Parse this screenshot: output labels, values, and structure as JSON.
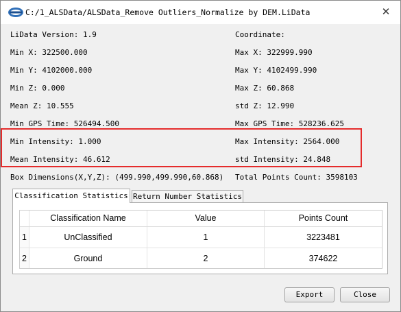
{
  "window": {
    "title": "C:/1_ALSData/ALSData_Remove Outliers_Normalize by DEM.LiData",
    "close_glyph": "✕",
    "icon": "lidar-logo-icon"
  },
  "stats": {
    "lidata_version": "LiData Version: 1.9",
    "coordinate": "Coordinate:",
    "min_x": "Min X: 322500.000",
    "max_x": "Max X: 322999.990",
    "min_y": "Min Y: 4102000.000",
    "max_y": "Max Y: 4102499.990",
    "min_z": "Min Z: 0.000",
    "max_z": "Max Z: 60.868",
    "mean_z": "Mean Z: 10.555",
    "std_z": "std Z: 12.990",
    "min_gps_time": "Min GPS Time: 526494.500",
    "max_gps_time": "Max GPS Time: 528236.625",
    "min_intensity": "Min Intensity: 1.000",
    "max_intensity": "Max Intensity: 2564.000",
    "mean_intensity": "Mean Intensity: 46.612",
    "std_intensity": "std Intensity: 24.848",
    "box_dimensions": "Box Dimensions(X,Y,Z): (499.990,499.990,60.868)",
    "total_points": "Total Points Count: 3598103"
  },
  "tabs": [
    {
      "label": "Classification Statistics",
      "active": true
    },
    {
      "label": "Return Number Statistics",
      "active": false
    }
  ],
  "table": {
    "headers": [
      "Classification Name",
      "Value",
      "Points Count"
    ],
    "rows": [
      {
        "num": "1",
        "name": "UnClassified",
        "value": "1",
        "count": "3223481"
      },
      {
        "num": "2",
        "name": "Ground",
        "value": "2",
        "count": "374622"
      }
    ]
  },
  "buttons": {
    "export": "Export",
    "close": "Close"
  },
  "colors": {
    "highlight_border": "#e52b2b",
    "window_bg": "#f0f0f0"
  }
}
